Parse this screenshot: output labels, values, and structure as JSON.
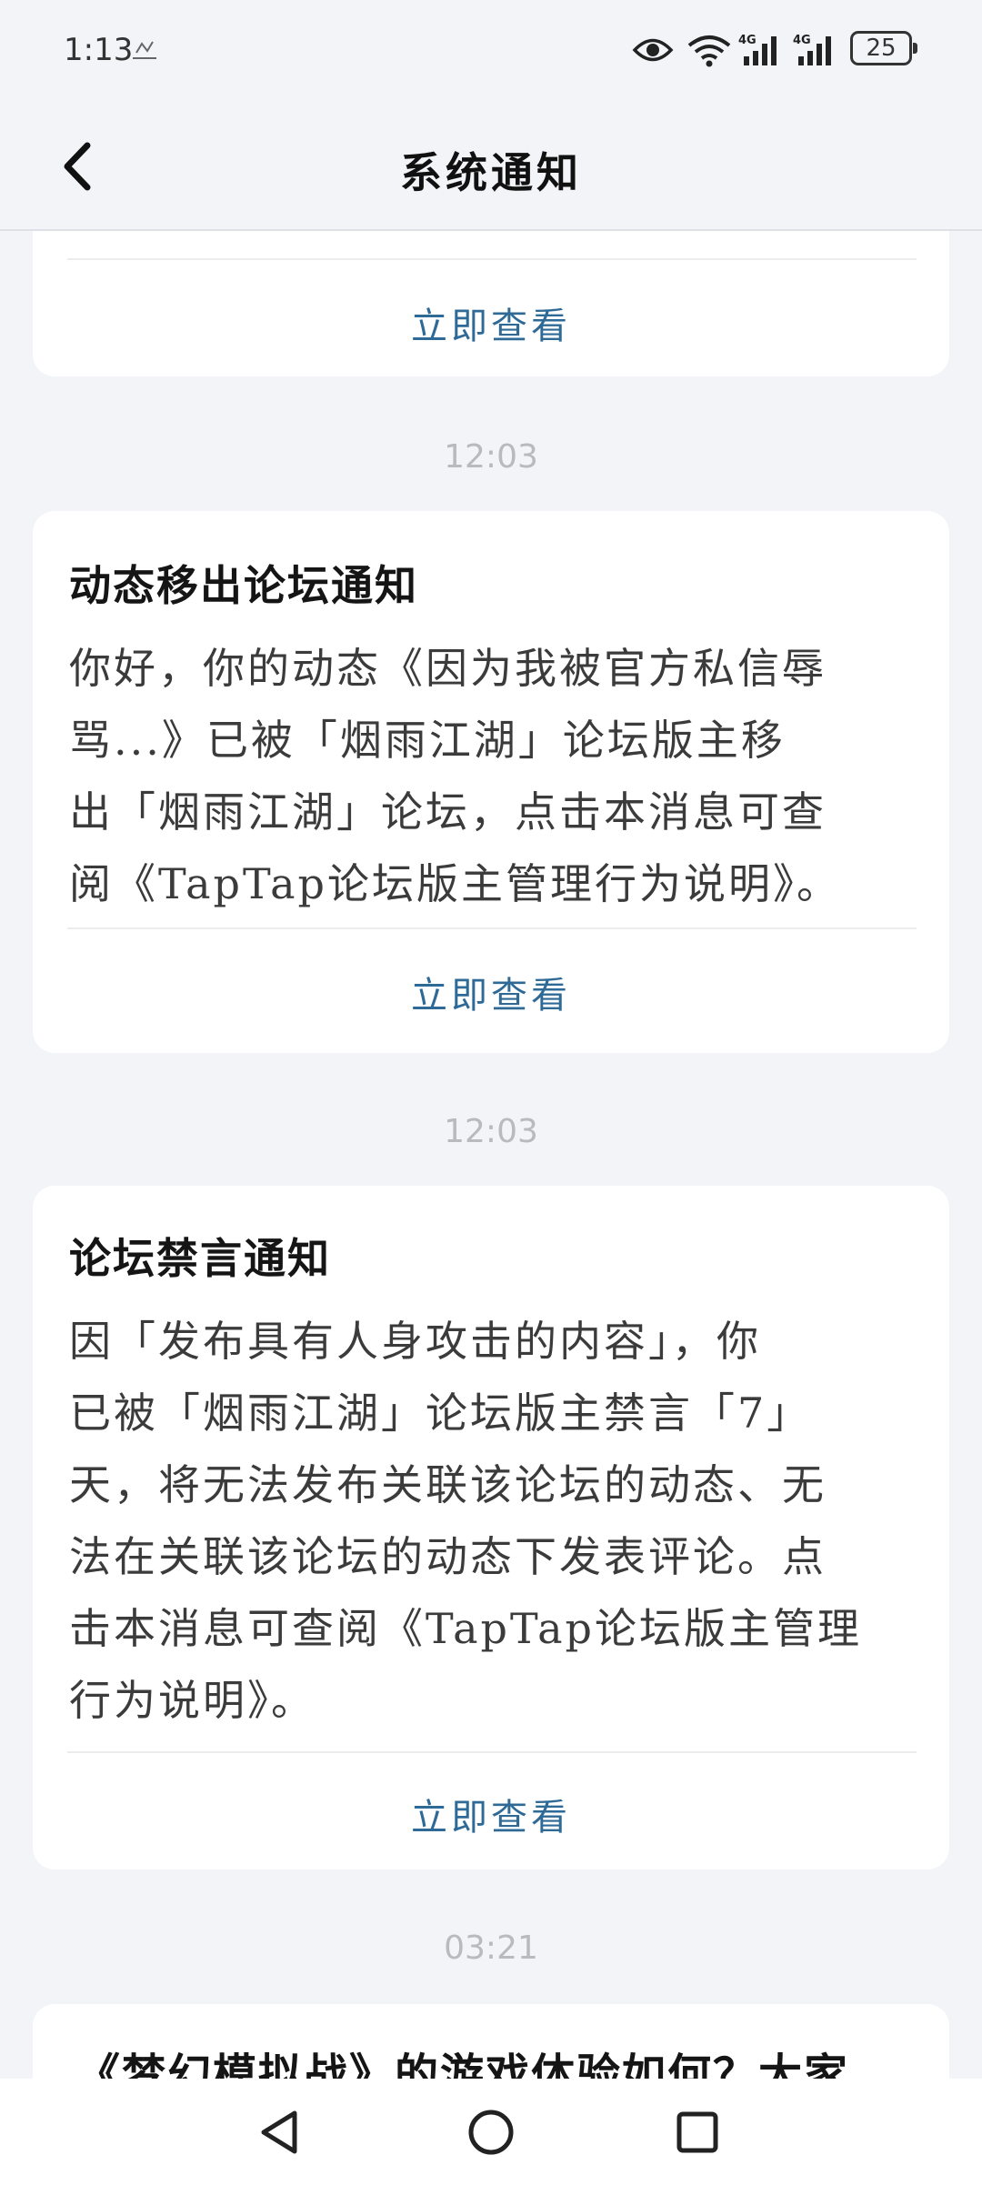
{
  "status_bar": {
    "time": "1:13",
    "battery": "25",
    "icons": [
      "notification-icon",
      "eye-icon",
      "wifi-icon",
      "signal-4g-icon",
      "signal-4g-icon",
      "battery-icon"
    ]
  },
  "header": {
    "title": "系统通知",
    "back_icon": "back-arrow-icon"
  },
  "notifications": [
    {
      "action": "立即查看"
    },
    {
      "time": "12:03",
      "title": "动态移出论坛通知",
      "body_lines": [
        "你好，你的动态《因为我被官方私信辱",
        "骂...》已被「烟雨江湖」论坛版主移",
        "出「烟雨江湖」论坛，点击本消息可查",
        "阅《TapTap论坛版主管理行为说明》。"
      ],
      "action": "立即查看"
    },
    {
      "time": "12:03",
      "title": "论坛禁言通知",
      "body_lines": [
        "因「发布具有人身攻击的内容」，你",
        "已被「烟雨江湖」论坛版主禁言「7」",
        "天，将无法发布关联该论坛的动态、无",
        "法在关联该论坛的动态下发表评论。点",
        "击本消息可查阅《TapTap论坛版主管理",
        "行为说明》。"
      ],
      "action": "立即查看"
    },
    {
      "time": "03:21",
      "title": "《梦幻模拟战》的游戏体验如何？大家"
    }
  ],
  "nav_bar": {
    "icons": [
      "back-triangle-icon",
      "home-circle-icon",
      "recents-square-icon"
    ]
  }
}
